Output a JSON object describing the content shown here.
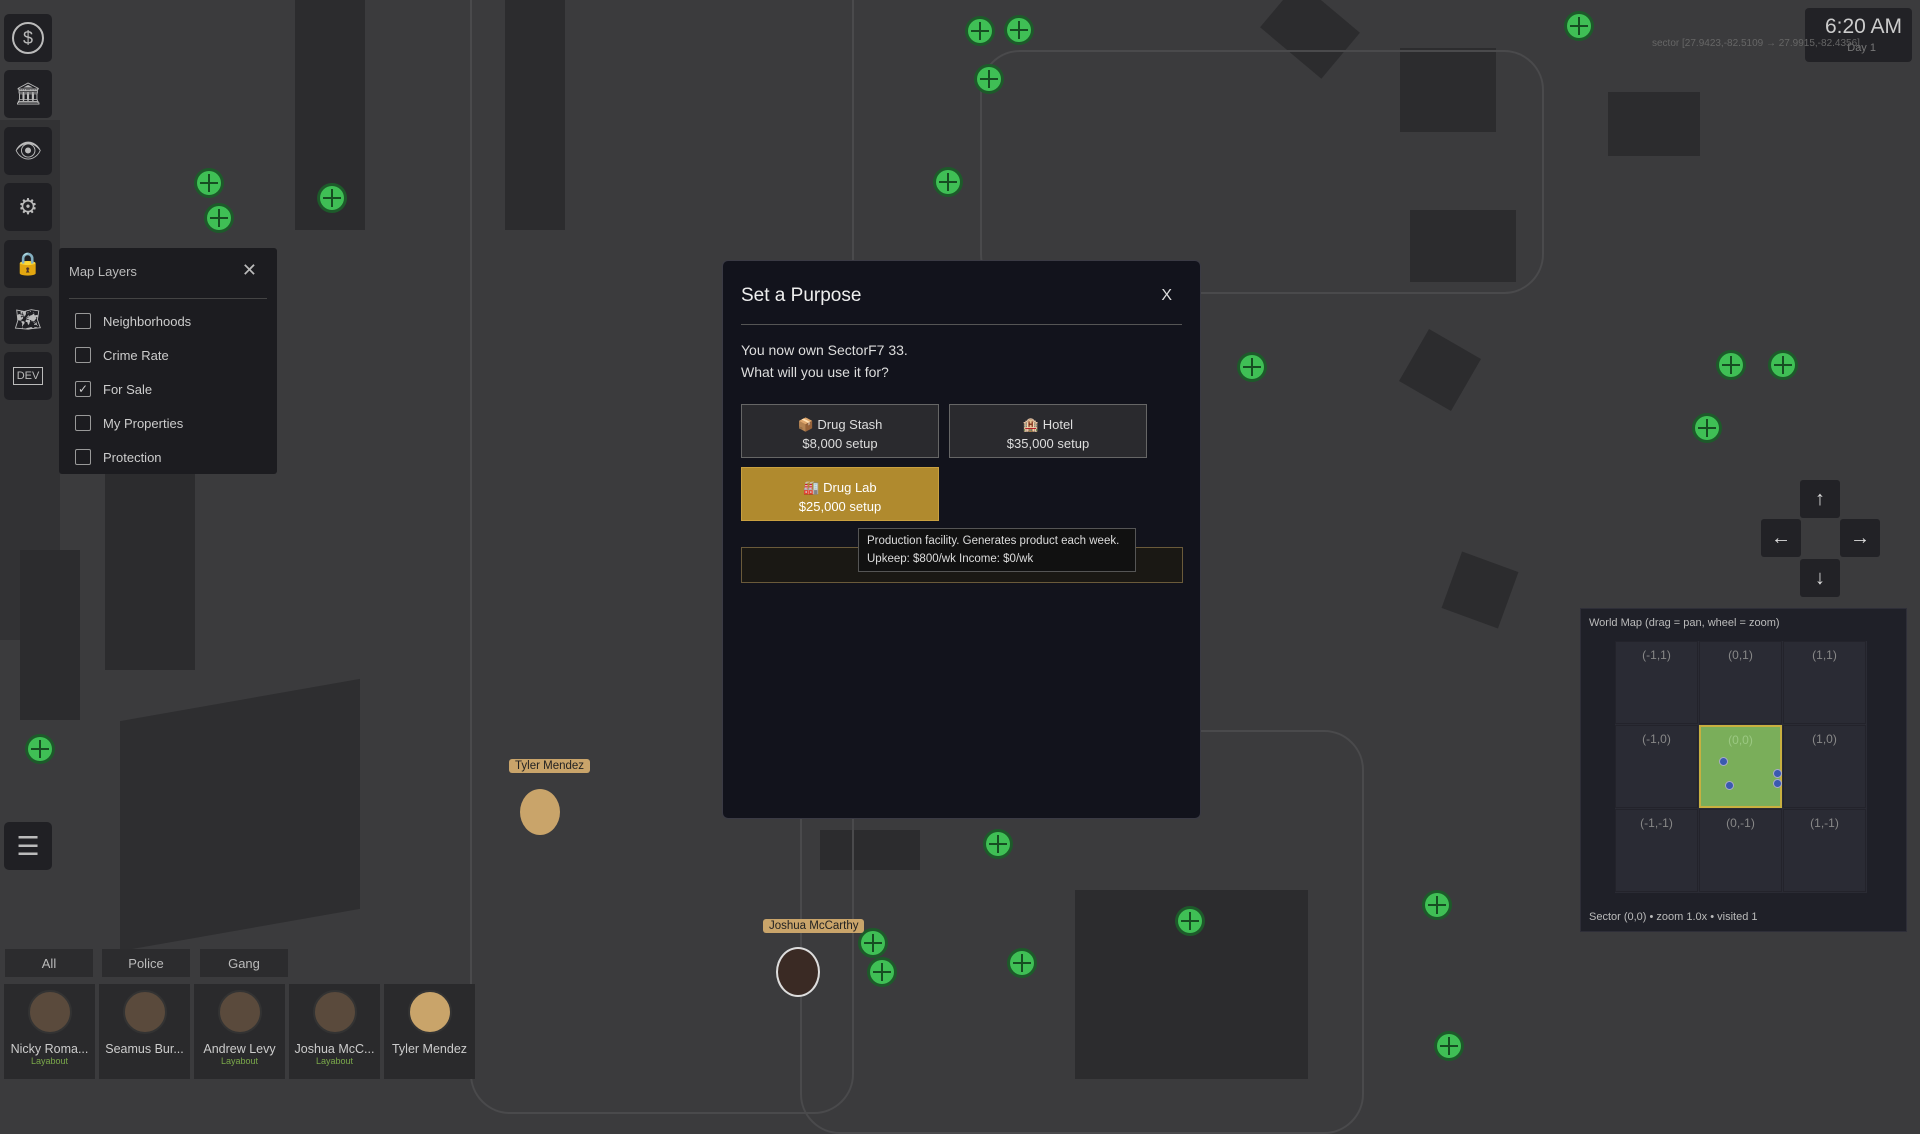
{
  "clock": {
    "time": "6:20 AM",
    "day": "Day 1"
  },
  "sector_coords": "sector [27.9423,-82.5109 → 27.9915,-82.4356]",
  "sidebar": {
    "items": [
      {
        "name": "money",
        "icon": "dollar-icon"
      },
      {
        "name": "bank",
        "icon": "bank-icon"
      },
      {
        "name": "surveillance",
        "icon": "eye-screen-icon"
      },
      {
        "name": "business",
        "icon": "gears-icon"
      },
      {
        "name": "lock",
        "icon": "lock-icon"
      },
      {
        "name": "map",
        "icon": "map-icon"
      },
      {
        "name": "dev",
        "icon": "dev-icon",
        "label": "DEV"
      },
      {
        "name": "menu",
        "icon": "hamburger-icon"
      }
    ]
  },
  "map_layers": {
    "title": "Map Layers",
    "items": [
      {
        "label": "Neighborhoods",
        "checked": false
      },
      {
        "label": "Crime Rate",
        "checked": false
      },
      {
        "label": "For Sale",
        "checked": true
      },
      {
        "label": "My Properties",
        "checked": false
      },
      {
        "label": "Protection",
        "checked": false
      }
    ]
  },
  "modal": {
    "title": "Set a Purpose",
    "close": "X",
    "message_line1": "You now own SectorF7 33.",
    "message_line2": "What will you use it for?",
    "options": [
      {
        "icon": "📦",
        "name": "Drug Stash",
        "cost": "$8,000 setup",
        "selected": false
      },
      {
        "icon": "🏨",
        "name": "Hotel",
        "cost": "$35,000 setup",
        "selected": false
      },
      {
        "icon": "🏭",
        "name": "Drug Lab",
        "cost": "$25,000 setup",
        "selected": true
      }
    ],
    "tooltip_line1": "Production facility. Generates product each week.",
    "tooltip_line2": "Upkeep: $800/wk  Income: $0/wk"
  },
  "nav_arrows": {
    "up": "↑",
    "left": "←",
    "right": "→",
    "down": "↓"
  },
  "world_map": {
    "title": "World Map (drag = pan, wheel = zoom)",
    "cells": [
      "(-1,1)",
      "(0,1)",
      "(1,1)",
      "(-1,0)",
      "(0,0)",
      "(1,0)",
      "(-1,-1)",
      "(0,-1)",
      "(1,-1)"
    ],
    "current": "(0,0)",
    "footer": "Sector (0,0) • zoom 1.0x • visited 1"
  },
  "filter_tabs": [
    "All",
    "Police",
    "Gang"
  ],
  "characters": [
    {
      "name": "Nicky Roma...",
      "status": "Layabout"
    },
    {
      "name": "Seamus Bur...",
      "status": ""
    },
    {
      "name": "Andrew Levy",
      "status": "Layabout"
    },
    {
      "name": "Joshua McC...",
      "status": "Layabout"
    },
    {
      "name": "Tyler Mendez",
      "status": ""
    }
  ],
  "npcs": [
    {
      "name": "Tyler Mendez"
    },
    {
      "name": "Joshua McCarthy"
    }
  ],
  "colors": {
    "accent": "#b08a2e",
    "marker": "#3fbf55",
    "modal_bg": "#12131c"
  }
}
